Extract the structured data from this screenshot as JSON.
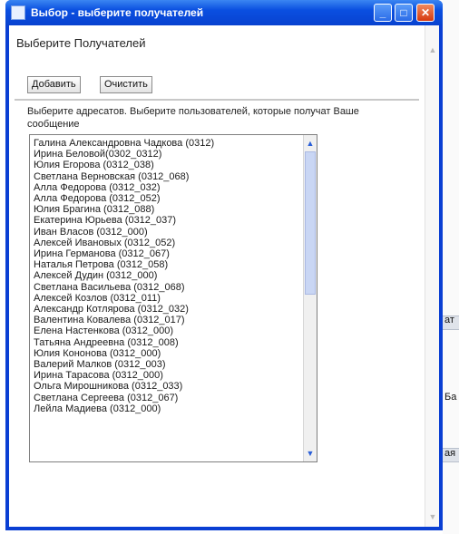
{
  "window": {
    "title": "Выбор - выберите получателей"
  },
  "dialog": {
    "heading": "Выберите Получателей",
    "add_label": "Добавить",
    "clear_label": "Очистить",
    "description": "Выберите адресатов. Выберите пользователей, которые получат Ваше сообщение"
  },
  "recipients": [
    "Галина Александровна Чадкова (0312)",
    "Ирина Беловой(0302_0312)",
    "Юлия Егорова (0312_038)",
    "Светлана Верновская (0312_068)",
    "Алла Федорова (0312_032)",
    "Алла Федорова (0312_052)",
    "Юлия Брагина (0312_088)",
    "Екатерина Юрьева (0312_037)",
    "Иван Власов (0312_000)",
    "Алексей Ивановых (0312_052)",
    "Ирина Германова (0312_067)",
    "Наталья Петрова (0312_058)",
    "Алексей Дудин (0312_000)",
    "Светлана Васильева (0312_068)",
    "Алексей Козлов (0312_011)",
    "Александр Котлярова (0312_032)",
    "Валентина Ковалева (0312_017)",
    "Елена Настенкова (0312_000)",
    "Татьяна Андреевна (0312_008)",
    "Юлия Кононова (0312_000)",
    "Валерий Малков (0312_003)",
    "Ирина Тарасова (0312_000)",
    "Ольга Мирошникова (0312_033)",
    "Светлана Сергеева (0312_067)",
    "Лейла Мадиева (0312_000)"
  ],
  "background_app": {
    "frag_1": "ат",
    "frag_2": "Ба",
    "frag_3": "ая"
  },
  "colors": {
    "titlebar": "#0842d0",
    "close_button": "#d63a10",
    "list_thumb": "#c9d6f4"
  }
}
